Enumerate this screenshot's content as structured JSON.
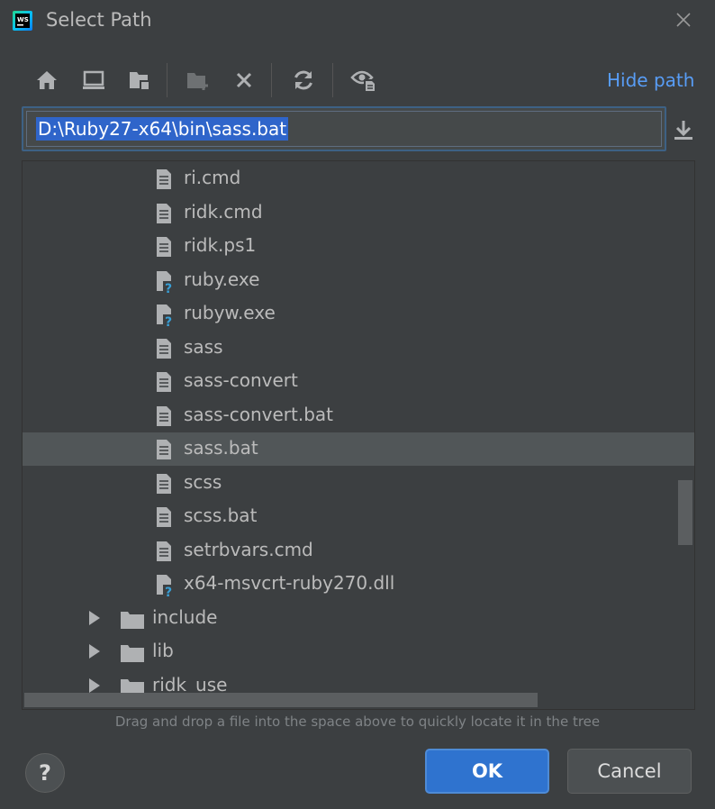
{
  "window": {
    "title": "Select Path",
    "icon": "webstorm-icon"
  },
  "toolbar": {
    "buttons": [
      {
        "name": "home-icon"
      },
      {
        "name": "desktop-icon"
      },
      {
        "name": "project-folder-icon"
      },
      {
        "name": "new-folder-icon"
      },
      {
        "name": "delete-icon"
      },
      {
        "name": "refresh-icon"
      },
      {
        "name": "show-hidden-icon"
      }
    ],
    "hide_path_label": "Hide path"
  },
  "path_field": {
    "value": "D:\\Ruby27-x64\\bin\\sass.bat"
  },
  "tree": {
    "items": [
      {
        "label": "ri.cmd",
        "type": "file",
        "selected": false
      },
      {
        "label": "ridk.cmd",
        "type": "file",
        "selected": false
      },
      {
        "label": "ridk.ps1",
        "type": "file",
        "selected": false
      },
      {
        "label": "ruby.exe",
        "type": "unknown-file",
        "selected": false
      },
      {
        "label": "rubyw.exe",
        "type": "unknown-file",
        "selected": false
      },
      {
        "label": "sass",
        "type": "file",
        "selected": false
      },
      {
        "label": "sass-convert",
        "type": "file",
        "selected": false
      },
      {
        "label": "sass-convert.bat",
        "type": "file",
        "selected": false
      },
      {
        "label": "sass.bat",
        "type": "file",
        "selected": true
      },
      {
        "label": "scss",
        "type": "file",
        "selected": false
      },
      {
        "label": "scss.bat",
        "type": "file",
        "selected": false
      },
      {
        "label": "setrbvars.cmd",
        "type": "file",
        "selected": false
      },
      {
        "label": "x64-msvcrt-ruby270.dll",
        "type": "unknown-file",
        "selected": false
      },
      {
        "label": "include",
        "type": "folder",
        "selected": false
      },
      {
        "label": "lib",
        "type": "folder",
        "selected": false
      },
      {
        "label": "ridk_use",
        "type": "folder",
        "selected": false
      }
    ]
  },
  "hint": "Drag and drop a file into the space above to quickly locate it in the tree",
  "buttons": {
    "help": "?",
    "ok": "OK",
    "cancel": "Cancel"
  },
  "colors": {
    "accent": "#2f73cf",
    "link": "#589df6",
    "background": "#3c3f41",
    "selection": "#515658"
  }
}
